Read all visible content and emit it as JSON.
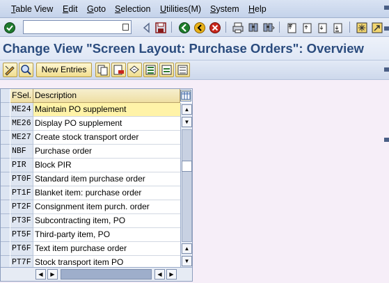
{
  "menubar": {
    "items": [
      {
        "label": "Table View",
        "mnemonic_index": 0
      },
      {
        "label": "Edit",
        "mnemonic_index": 0
      },
      {
        "label": "Goto",
        "mnemonic_index": 0
      },
      {
        "label": "Selection",
        "mnemonic_index": 0
      },
      {
        "label": "Utilities(M)",
        "mnemonic_index": 0
      },
      {
        "label": "System",
        "mnemonic_index": 0
      },
      {
        "label": "Help",
        "mnemonic_index": 0
      }
    ]
  },
  "std_toolbar": {
    "command_field_value": "",
    "icons": [
      "enter-icon",
      "back-arrow-icon",
      "save-icon",
      "back-icon",
      "exit-icon",
      "cancel-icon",
      "print-icon",
      "find-icon",
      "find-next-icon",
      "first-page-icon",
      "previous-page-icon",
      "next-page-icon",
      "last-page-icon",
      "create-session-icon",
      "shortcut-icon"
    ]
  },
  "title": "Change View \"Screen Layout: Purchase Orders\": Overview",
  "app_toolbar": {
    "new_entries_label": "New Entries",
    "icons": [
      "display-change-icon",
      "other-view-icon",
      "copy-as-icon",
      "delete-icon",
      "undo-change-icon",
      "select-all-icon",
      "select-block-icon",
      "deselect-all-icon"
    ]
  },
  "table": {
    "headers": [
      "FSel.",
      "Description"
    ],
    "rows": [
      {
        "code": "ME24",
        "description": "Maintain PO supplement",
        "focused": true
      },
      {
        "code": "ME26",
        "description": "Display PO supplement",
        "focused": false
      },
      {
        "code": "ME27",
        "description": "Create stock transport order",
        "focused": false
      },
      {
        "code": "NBF",
        "description": "Purchase order",
        "focused": false
      },
      {
        "code": "PIR",
        "description": "Block PIR",
        "focused": false
      },
      {
        "code": "PT0F",
        "description": "Standard item purchase order",
        "focused": false
      },
      {
        "code": "PT1F",
        "description": "Blanket item: purchase order",
        "focused": false
      },
      {
        "code": "PT2F",
        "description": "Consignment item purch. order",
        "focused": false
      },
      {
        "code": "PT3F",
        "description": "Subcontracting item, PO",
        "focused": false
      },
      {
        "code": "PT5F",
        "description": "Third-party item, PO",
        "focused": false
      },
      {
        "code": "PT6F",
        "description": "Text item purchase order",
        "focused": false
      },
      {
        "code": "PT7F",
        "description": "Stock transport item PO",
        "focused": false
      }
    ]
  },
  "colors": {
    "title_text": "#2b4c7e",
    "focused_row": "#fff3a8",
    "header_bg": "#efdfa3",
    "background": "#f6eef8"
  }
}
